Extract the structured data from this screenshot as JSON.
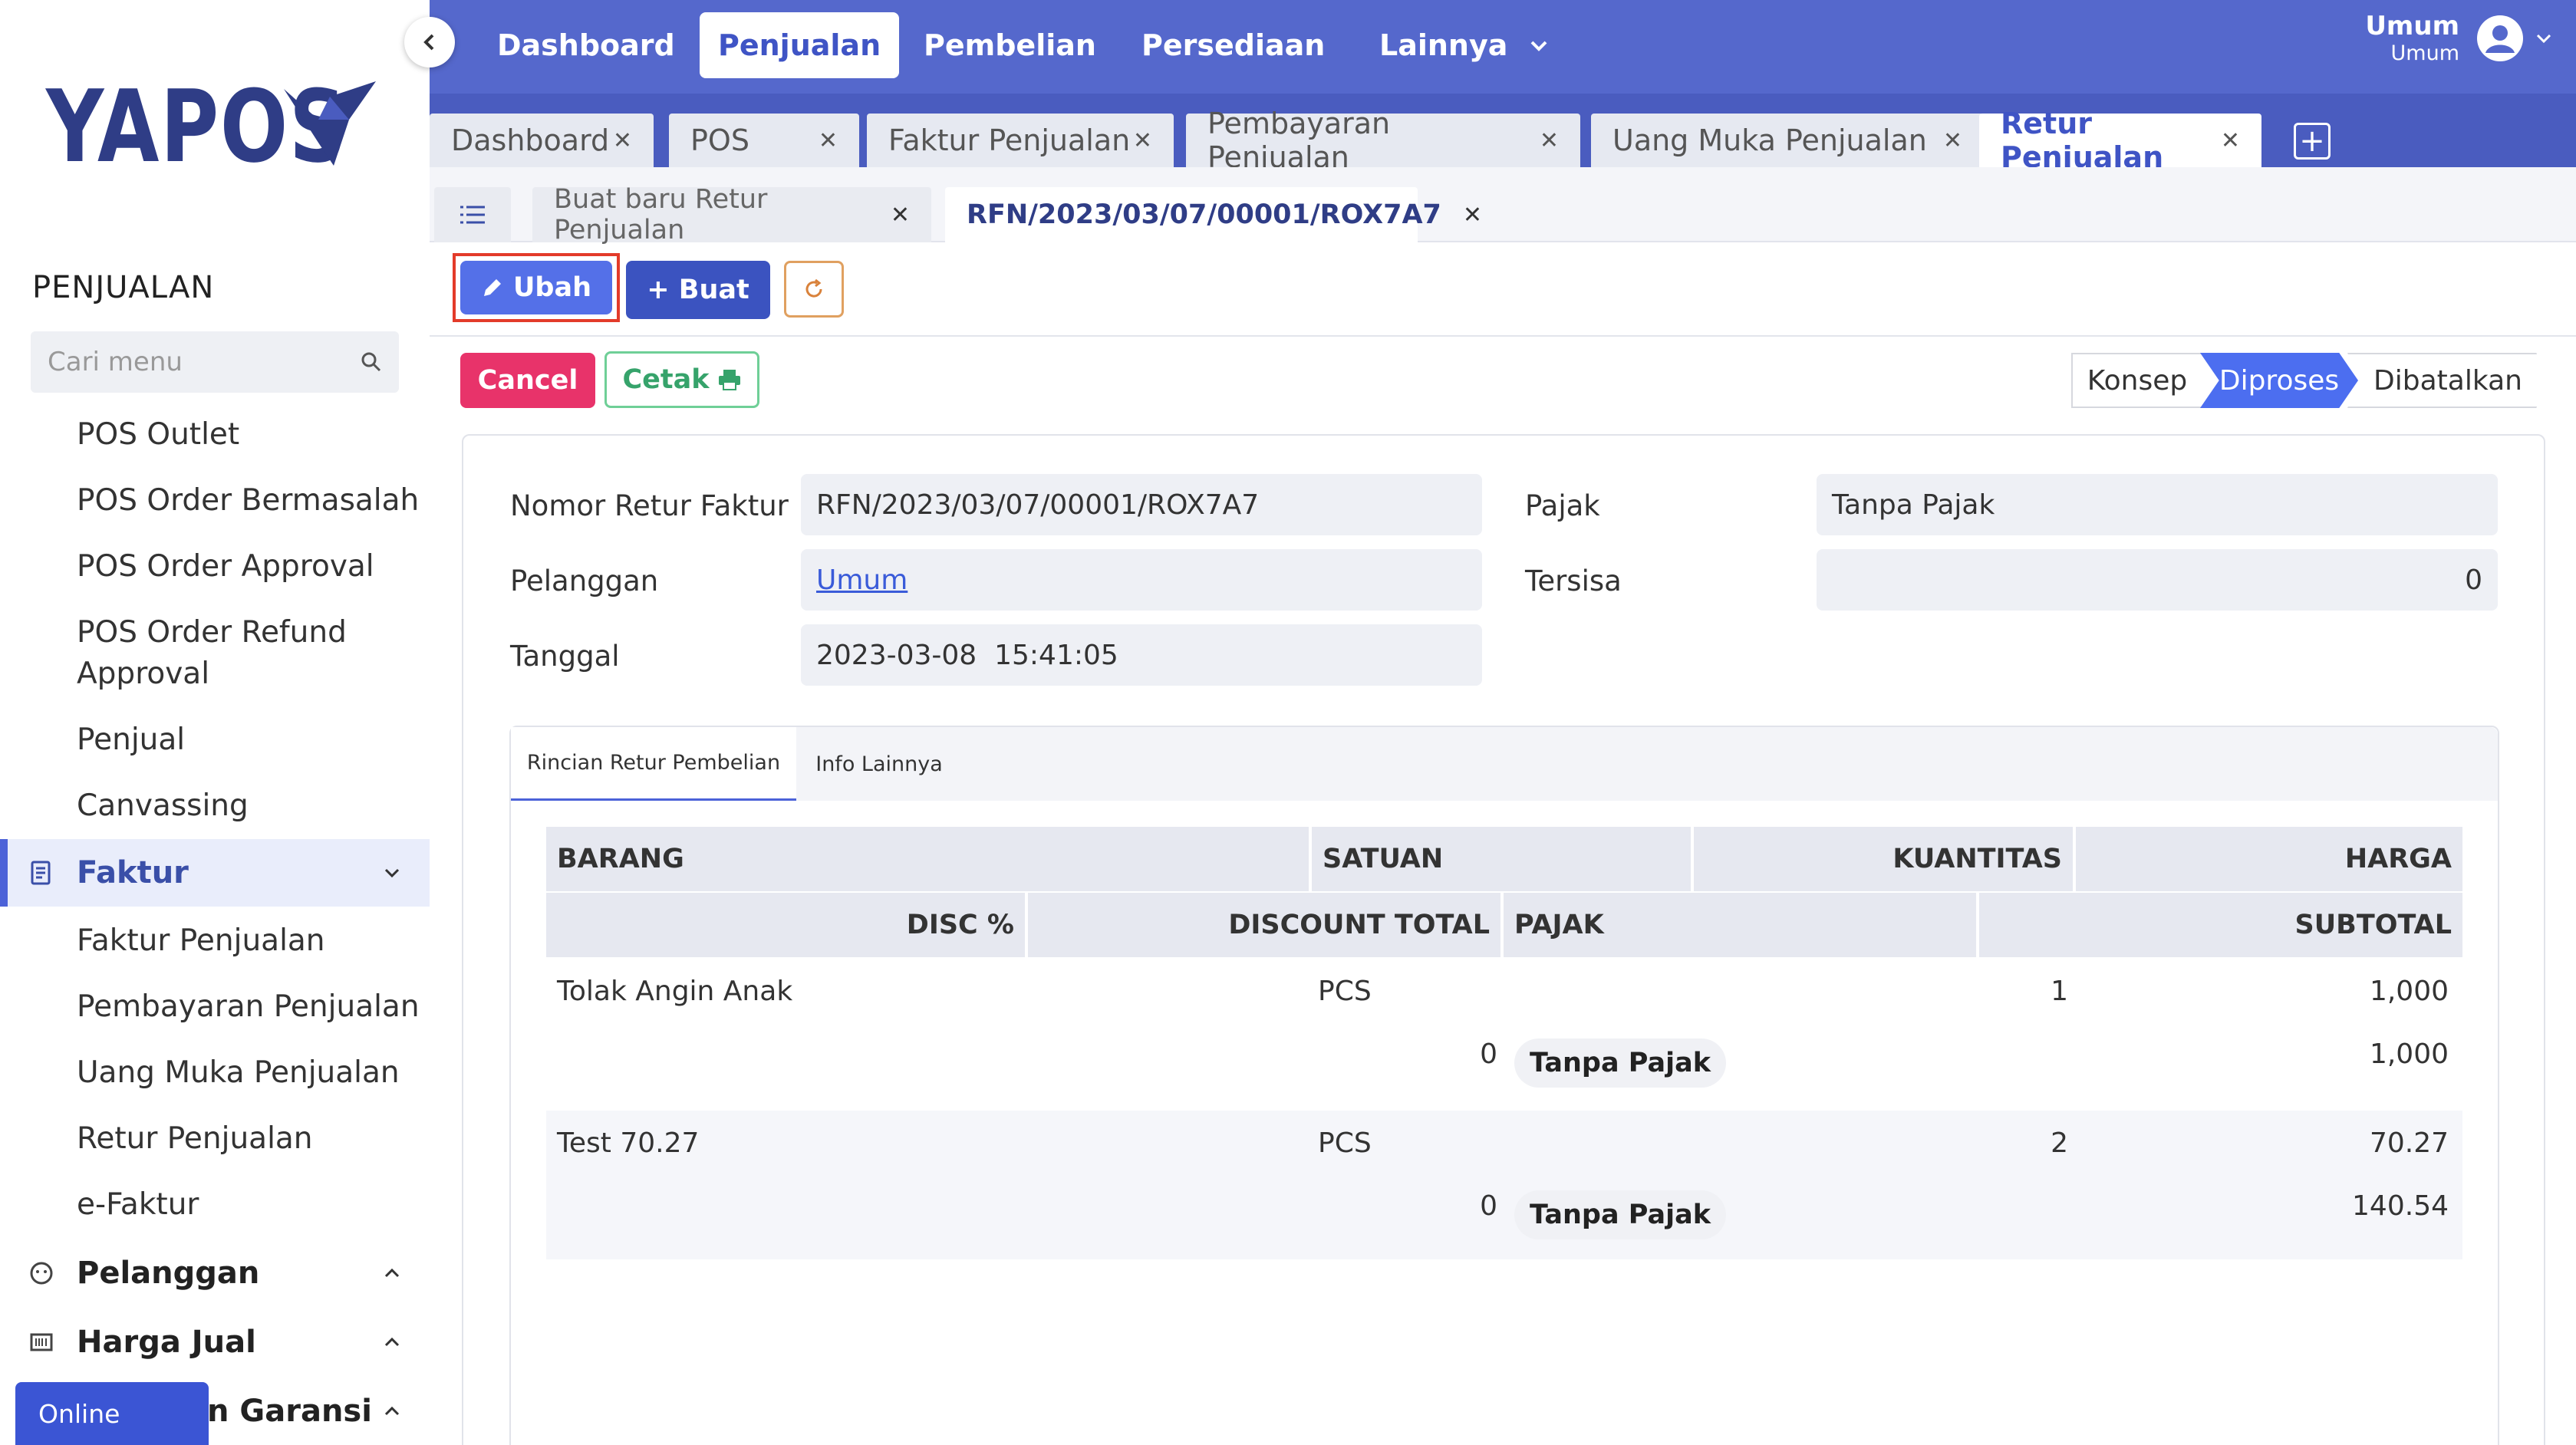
{
  "sidebar": {
    "logo": "YAPOS",
    "section": "PENJUALAN",
    "search_placeholder": "Cari menu",
    "items_top": [
      "POS Outlet",
      "POS Order Bermasalah",
      "POS Order Approval",
      "POS Order Refund",
      "Approval",
      "Penjual",
      "Canvassing"
    ],
    "faktur_group": "Faktur",
    "items_faktur": [
      "Faktur Penjualan",
      "Pembayaran Penjualan",
      "Uang Muka Penjualan",
      "Retur Penjualan",
      "e-Faktur"
    ],
    "groups": [
      "Pelanggan",
      "Harga Jual",
      "n Garansi"
    ],
    "online": "Online"
  },
  "topnav": {
    "items": [
      "Dashboard",
      "Penjualan",
      "Pembelian",
      "Persediaan",
      "Lainnya"
    ],
    "user_name": "Umum",
    "user_sub": "Umum"
  },
  "tabs": [
    "Dashboard",
    "POS",
    "Faktur Penjualan",
    "Pembayaran Penjualan",
    "Uang Muka Penjualan",
    "Retur Penjualan"
  ],
  "subtabs": [
    "Buat baru Retur Penjualan",
    "RFN/2023/03/07/00001/ROX7A7"
  ],
  "toolbar": {
    "ubah": "Ubah",
    "buat": "+ Buat",
    "cancel": "Cancel",
    "cetak": "Cetak"
  },
  "status": [
    "Konsep",
    "Diproses",
    "Dibatalkan"
  ],
  "form": {
    "nomor_label": "Nomor Retur Faktur",
    "nomor_value": "RFN/2023/03/07/00001/ROX7A7",
    "pelanggan_label": "Pelanggan",
    "pelanggan_value": "Umum",
    "tanggal_label": "Tanggal",
    "tanggal_value": "2023-03-08  15:41:05",
    "pajak_label": "Pajak",
    "pajak_value": "Tanpa Pajak",
    "tersisa_label": "Tersisa",
    "tersisa_value": "0"
  },
  "inner_tabs": [
    "Rincian Retur Pembelian",
    "Info Lainnya"
  ],
  "table": {
    "headers1": [
      "BARANG",
      "SATUAN",
      "KUANTITAS",
      "HARGA"
    ],
    "headers2": [
      "DISC %",
      "DISCOUNT TOTAL",
      "PAJAK",
      "SUBTOTAL"
    ],
    "rows": [
      {
        "barang": "Tolak Angin Anak",
        "satuan": "PCS",
        "kuantitas": "1",
        "harga": "1,000",
        "disc": "0",
        "pajak": "Tanpa Pajak",
        "subtotal": "1,000"
      },
      {
        "barang": "Test 70.27",
        "satuan": "PCS",
        "kuantitas": "2",
        "harga": "70.27",
        "disc": "0",
        "pajak": "Tanpa Pajak",
        "subtotal": "140.54"
      }
    ]
  }
}
